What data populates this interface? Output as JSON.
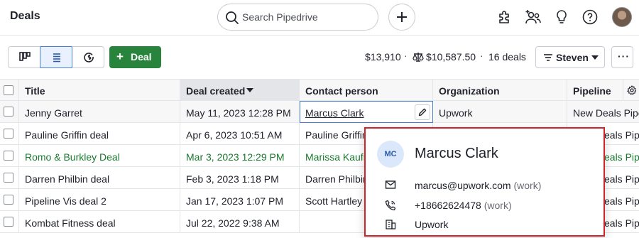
{
  "header": {
    "title": "Deals",
    "search_placeholder": "Search Pipedrive"
  },
  "toolbar": {
    "add_deal_label": "Deal",
    "total_value": "$13,910",
    "weighted_value": "$10,587.50",
    "deal_count": "16 deals",
    "filter_label": "Steven",
    "more_label": "···",
    "accent_color": "#28843d"
  },
  "table": {
    "columns": [
      "Title",
      "Deal created",
      "Contact person",
      "Organization",
      "Pipeline"
    ],
    "rows": [
      {
        "title": "Jenny Garret",
        "created": "May 11, 2023 12:28 PM",
        "contact": "Marcus Clark",
        "organization": "Upwork",
        "pipeline": "New Deals Pipe"
      },
      {
        "title": "Pauline Griffin deal",
        "created": "Apr 6, 2023 10:51 AM",
        "contact": "Pauline Griffin",
        "organization": "",
        "pipeline": "eals Pipe"
      },
      {
        "title": "Romo & Burkley Deal",
        "created": "Mar 3, 2023 12:29 PM",
        "contact": "Marissa Kaufm",
        "organization": "",
        "pipeline": "eals Pipe"
      },
      {
        "title": "Darren Philbin deal",
        "created": "Feb 3, 2023 1:18 PM",
        "contact": "Darren Philbin",
        "organization": "",
        "pipeline": "eals Pipe"
      },
      {
        "title": "Pipeline Vis deal 2",
        "created": "Jan 17, 2023 1:07 PM",
        "contact": "Scott Hartley",
        "organization": "",
        "pipeline": "eals Pipe"
      },
      {
        "title": "Kombat Fitness deal",
        "created": "Jul 22, 2022 9:38 AM",
        "contact": "",
        "organization": "",
        "pipeline": "eals Pipe"
      }
    ]
  },
  "popover": {
    "initials": "MC",
    "name": "Marcus Clark",
    "email": "marcus@upwork.com",
    "email_type": "(work)",
    "phone": "+18662624478",
    "phone_type": "(work)",
    "organization": "Upwork"
  }
}
